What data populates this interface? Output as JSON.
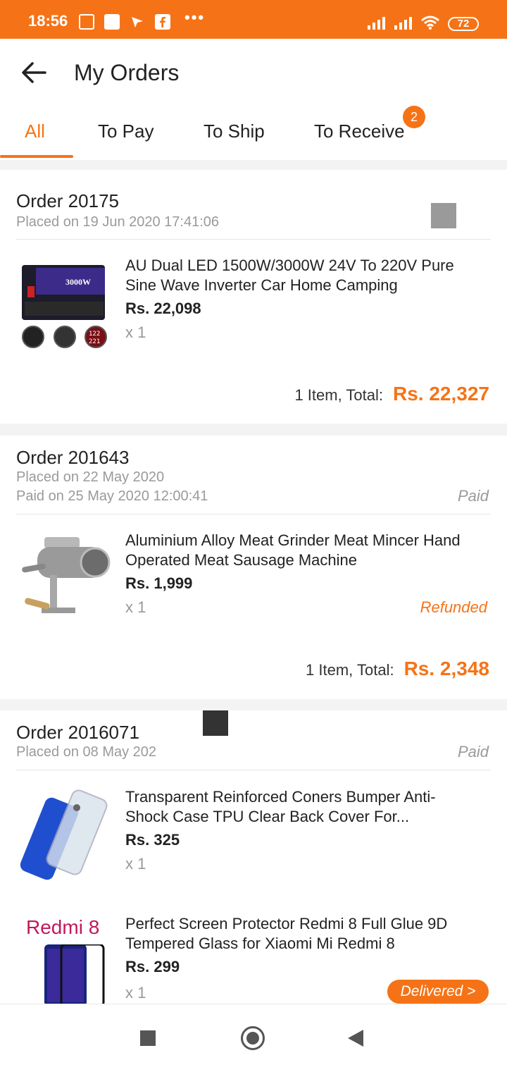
{
  "status_bar": {
    "time": "18:56",
    "dots": "•••",
    "battery": "72"
  },
  "header": {
    "title": "My Orders"
  },
  "tabs": [
    {
      "label": "All",
      "active": true
    },
    {
      "label": "To Pay",
      "active": false
    },
    {
      "label": "To Ship",
      "active": false
    },
    {
      "label": "To Receive",
      "active": false,
      "badge": "2"
    }
  ],
  "orders": [
    {
      "order_no": "Order 20175",
      "placed": "Placed on 19 Jun 2020  17:41:06",
      "items": [
        {
          "name": "AU Dual LED 1500W/3000W 24V To 220V Pure Sine Wave Inverter Car Home Camping",
          "price": "Rs. 22,098",
          "qty": "x 1"
        }
      ],
      "total_label": "1 Item, Total:",
      "total": "Rs. 22,327"
    },
    {
      "order_no": "Order 201643",
      "placed": "Placed on 22 May 2020",
      "paid_on": "Paid on 25 May 2020  12:00:41",
      "status": "Paid",
      "items": [
        {
          "name": "Aluminium Alloy Meat Grinder Meat Mincer Hand Operated Meat Sausage Machine",
          "price": "Rs. 1,999",
          "qty": "x 1",
          "item_status": "Refunded"
        }
      ],
      "total_label": "1 Item, Total:",
      "total": "Rs. 2,348"
    },
    {
      "order_no": "Order 2016071",
      "placed": "Placed on 08 May 202",
      "status": "Paid",
      "items": [
        {
          "name": "Transparent Reinforced Coners Bumper Anti-Shock Case TPU Clear Back Cover For...",
          "price": "Rs. 325",
          "qty": "x 1"
        },
        {
          "name": "Perfect Screen Protector Redmi 8 Full Glue 9D Tempered Glass for Xiaomi Mi Redmi 8",
          "price": "Rs. 299",
          "qty": "x 1",
          "action": "Delivered >",
          "thumb_text": "Redmi 8"
        }
      ]
    }
  ],
  "colors": {
    "accent": "#f57316",
    "muted": "#9a9a9a"
  },
  "icons": [
    "back-arrow-icon",
    "square-nav-icon",
    "home-circle-icon",
    "triangle-back-icon"
  ]
}
